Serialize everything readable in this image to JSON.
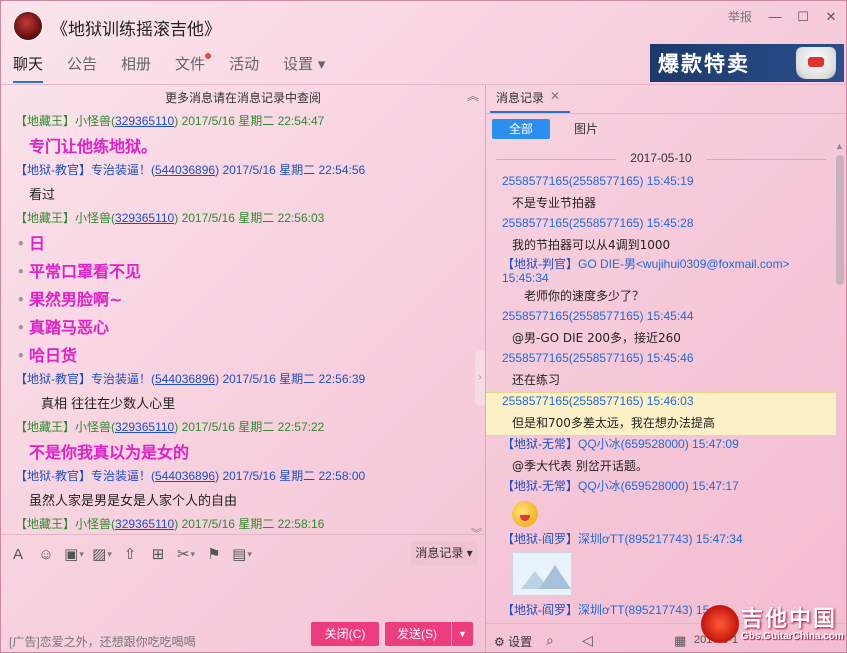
{
  "window": {
    "title": "《地狱训练摇滚吉他》",
    "report": "举报",
    "minimize": "—",
    "maximize": "☐",
    "close": "✕"
  },
  "tabs": [
    {
      "label": "聊天",
      "active": true
    },
    {
      "label": "公告"
    },
    {
      "label": "相册"
    },
    {
      "label": "文件",
      "badge": true
    },
    {
      "label": "活动"
    },
    {
      "label": "设置 ▾"
    }
  ],
  "ad_banner": {
    "text": "爆款特卖"
  },
  "chat": {
    "more_hint": "更多消息请在消息记录中查阅",
    "collapse_icon": "chevrons-up",
    "messages": [
      {
        "tag": "【地藏王】",
        "name": "小怪兽",
        "qq": "329365110",
        "time": "2017/5/16 星期二 22:54:47",
        "color": "green",
        "body": [
          "专门让他练地狱。"
        ],
        "style": "pink"
      },
      {
        "tag": "【地狱-教官】",
        "name": "专治装逼！",
        "qq": "544036896",
        "time": "2017/5/16 星期二 22:54:56",
        "color": "blue",
        "body": [
          "看过"
        ],
        "style": "plain"
      },
      {
        "tag": "【地藏王】",
        "name": "小怪兽",
        "qq": "329365110",
        "time": "2017/5/16 星期二 22:56:03",
        "color": "green",
        "body": [
          "日",
          "平常口罩看不见",
          "果然男脸啊~",
          "真踏马恶心",
          "哈日货"
        ],
        "style": "pink-bullets"
      },
      {
        "tag": "【地狱-教官】",
        "name": "专治装逼！",
        "qq": "544036896",
        "time": "2017/5/16 星期二 22:56:39",
        "color": "blue",
        "body": [
          "真相  往往在少数人心里"
        ],
        "style": "plain-indent"
      },
      {
        "tag": "【地藏王】",
        "name": "小怪兽",
        "qq": "329365110",
        "time": "2017/5/16 星期二 22:57:22",
        "color": "green",
        "body": [
          "不是你我真以为是女的"
        ],
        "style": "pink"
      },
      {
        "tag": "【地狱-教官】",
        "name": "专治装逼！",
        "qq": "544036896",
        "time": "2017/5/16 星期二 22:58:00",
        "color": "blue",
        "body": [
          "虽然人家是男是女是人家个人的自由"
        ],
        "style": "plain"
      },
      {
        "tag": "【地藏王】",
        "name": "小怪兽",
        "qq": "329365110",
        "time": "2017/5/16 星期二 22:58:16",
        "color": "green",
        "body": [],
        "style": "plain"
      }
    ]
  },
  "toolbar": {
    "font": "A",
    "emoji": "☺",
    "gif": "▣",
    "image": "▨",
    "upload": "⇧",
    "gift": "⊞",
    "scissors": "✂",
    "shake": "⚑",
    "screen": "▤",
    "history_button": "消息记录 ▾"
  },
  "bottom": {
    "ad_text": "[广告]恋爱之外，还想跟你吃吃喝喝",
    "close_button": "关闭(C)",
    "send_button": "发送(S)"
  },
  "history": {
    "tab_label": "消息记录",
    "tab_close": "✕",
    "seg_all": "全部",
    "seg_pictures": "图片",
    "date": "2017-05-10",
    "entries": [
      {
        "meta": "2558577165(2558577165) 15:45:19",
        "body": "不是专业节拍器"
      },
      {
        "meta": "2558577165(2558577165) 15:45:28",
        "body": "我的节拍器可以从4调到1000"
      },
      {
        "meta_tag": "【地狱-判官】",
        "meta": "GO DIE-男<wujihui0309@foxmail.com> 15:45:34",
        "body": "老师你的速度多少了？",
        "wrap": true,
        "deep": true
      },
      {
        "meta": "2558577165(2558577165) 15:45:44",
        "body": "@男-GO DIE 200多，接近260"
      },
      {
        "meta": "2558577165(2558577165) 15:45:46",
        "body": "还在练习"
      },
      {
        "meta": "2558577165(2558577165) 15:46:03",
        "body": "但是和700多差太远，我在想办法提高",
        "highlight": true
      },
      {
        "meta_tag": "【地狱-无常】",
        "meta": "QQ小冰(659528000) 15:47:09",
        "body": "@季大代表 别岔开话题。"
      },
      {
        "meta_tag": "【地狱-无常】",
        "meta": "QQ小冰(659528000) 15:47:17",
        "body": "",
        "emoji": true
      },
      {
        "meta_tag": "【地狱-阎罗】",
        "meta": "深圳ơTT(895217743) 15:47:34",
        "body": "",
        "image": true
      },
      {
        "meta_tag": "【地狱-阎罗】",
        "meta": "深圳ơTT(895217743) 15:4",
        "body": ""
      }
    ],
    "settings_label": "设置",
    "bottom_date": "2017-5-1"
  },
  "watermark": {
    "main": "吉他中国",
    "sub": "Gbs.GuitarChina.com"
  }
}
